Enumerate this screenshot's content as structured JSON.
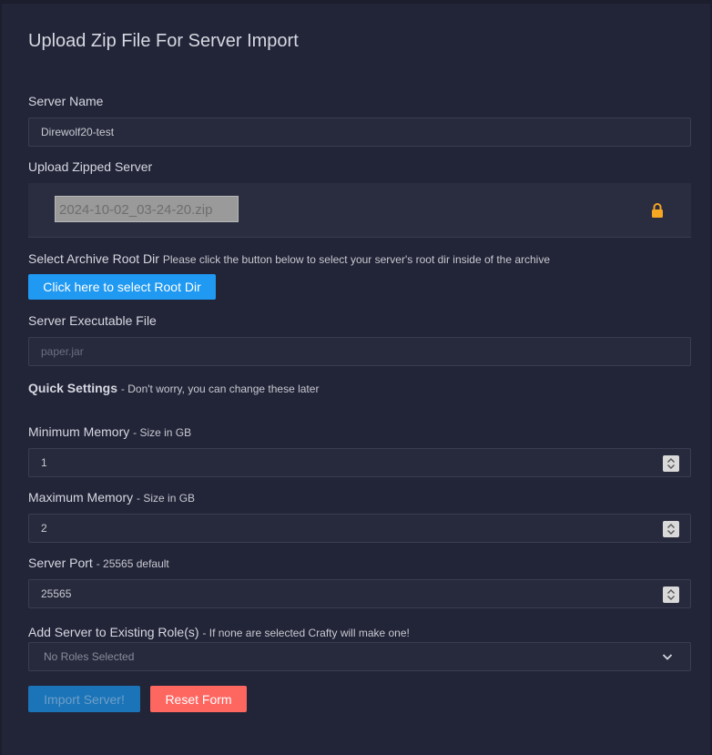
{
  "form": {
    "title": "Upload Zip File For Server Import",
    "server_name": {
      "label": "Server Name",
      "value": "Direwolf20-test"
    },
    "upload": {
      "label": "Upload Zipped Server",
      "file_name": "2024-10-02_03-24-20.zip",
      "icon": "lock-icon"
    },
    "archive_root": {
      "label": "Select Archive Root Dir",
      "hint": "Please click the button below to select your server's root dir inside of the archive",
      "button_label": "Click here to select Root Dir"
    },
    "executable": {
      "label": "Server Executable File",
      "placeholder": "paper.jar"
    },
    "quick_settings": {
      "label": "Quick Settings",
      "hint": "- Don't worry, you can change these later"
    },
    "min_memory": {
      "label": "Minimum Memory",
      "hint": "- Size in GB",
      "value": "1"
    },
    "max_memory": {
      "label": "Maximum Memory",
      "hint": "- Size in GB",
      "value": "2"
    },
    "port": {
      "label": "Server Port",
      "hint": "- 25565 default",
      "value": "25565"
    },
    "roles": {
      "label": "Add Server to Existing Role(s)",
      "hint": "- If none are selected Crafty will make one!",
      "selected": "No Roles Selected"
    },
    "import_button": "Import Server!",
    "reset_button": "Reset Form"
  },
  "colors": {
    "page_bg": "#1c1e2e",
    "card_bg": "#222437",
    "primary": "#1f99f1",
    "danger": "#fe6660",
    "lock": "#f5a623"
  }
}
